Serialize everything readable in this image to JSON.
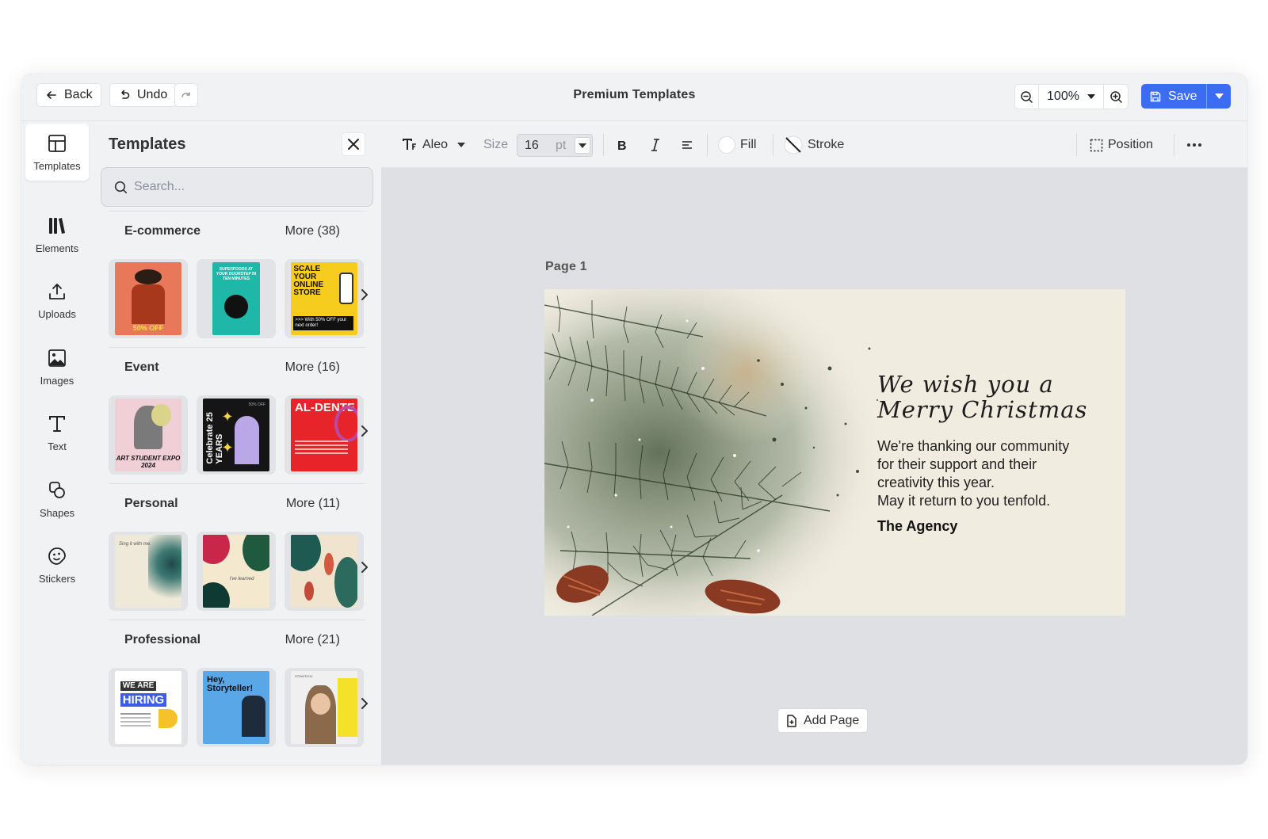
{
  "topbar": {
    "back_label": "Back",
    "undo_label": "Undo",
    "title": "Premium Templates",
    "zoom": "100%",
    "save_label": "Save"
  },
  "rail": {
    "items": [
      {
        "label": "Templates",
        "icon": "layout-icon"
      },
      {
        "label": "Elements",
        "icon": "elements-icon"
      },
      {
        "label": "Uploads",
        "icon": "upload-icon"
      },
      {
        "label": "Images",
        "icon": "image-icon"
      },
      {
        "label": "Text",
        "icon": "text-icon"
      },
      {
        "label": "Shapes",
        "icon": "shapes-icon"
      },
      {
        "label": "Stickers",
        "icon": "sticker-icon"
      }
    ]
  },
  "panel": {
    "title": "Templates",
    "search_placeholder": "Search...",
    "categories": [
      {
        "name": "E-commerce",
        "more": "More (38)",
        "thumbs": [
          {
            "text": "50% OFF",
            "bg": "#e9785a"
          },
          {
            "text": "SUPERFOODS AT YOUR DOORSTEP IN TEN MINUTES",
            "bg": "#1fb7a8"
          },
          {
            "text": "SCALE YOUR ONLINE STORE",
            "sub": ">>> With 50% OFF your next order!",
            "bg": "#f6cc1f"
          }
        ]
      },
      {
        "name": "Event",
        "more": "More (16)",
        "thumbs": [
          {
            "text": "ART STUDENT EXPO 2024",
            "bg": "#f0cfd7"
          },
          {
            "text": "Celebrate 25 YEARS",
            "sub": "50% OFF",
            "bg": "#151515"
          },
          {
            "text": "AL-DENTE",
            "bg": "#e8242b"
          }
        ]
      },
      {
        "name": "Personal",
        "more": "More (11)",
        "thumbs": [
          {
            "text": "Sing it with me.",
            "bg": "#efe9d9"
          },
          {
            "text": "I've learned",
            "bg": "#f4e9cf"
          },
          {
            "text": "",
            "bg": "#f0e4cf"
          }
        ]
      },
      {
        "name": "Professional",
        "more": "More (21)",
        "thumbs": [
          {
            "text": "WE ARE",
            "sub": "HIRING",
            "bg": "#ffffff"
          },
          {
            "text": "Hey, Storyteller!",
            "bg": "#5aa7e8"
          },
          {
            "text": "STRATEGIC",
            "bg": "#f0f0f0"
          }
        ]
      }
    ]
  },
  "toolbar": {
    "font": "Aleo",
    "size_label": "Size",
    "size_value": "16",
    "size_unit": "pt",
    "fill_label": "Fill",
    "stroke_label": "Stroke",
    "position_label": "Position"
  },
  "canvas": {
    "page_label": "Page 1",
    "script_line1": "We wish you a",
    "script_line2": "Merry Christmas",
    "body_lines": [
      "We're thanking our community",
      "for their support and their",
      "creativity this year.",
      "May it return to you tenfold."
    ],
    "signature": "The Agency",
    "add_page_label": "Add Page"
  },
  "colors": {
    "accent": "#3b6cf2",
    "panel_bg": "#f1f2f4",
    "canvas_bg": "#dee0e3",
    "card_bg": "#f1ece0"
  }
}
